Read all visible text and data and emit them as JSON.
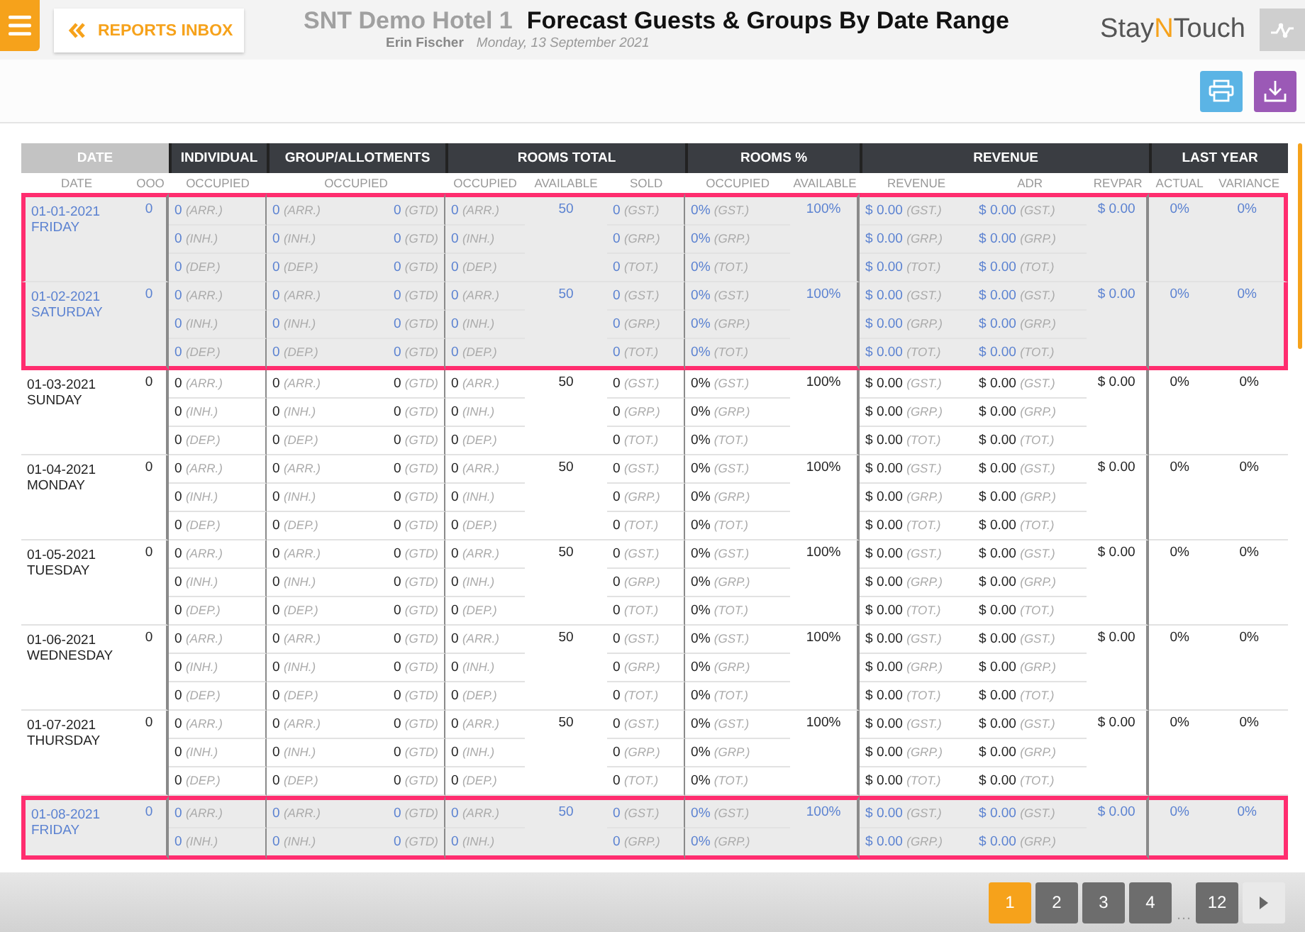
{
  "header": {
    "back_button": "REPORTS INBOX",
    "hotel": "SNT Demo Hotel 1",
    "report_title": "Forecast Guests & Groups By Date Range",
    "user": "Erin Fischer",
    "date": "Monday, 13 September 2021",
    "logo": {
      "before": "Stay",
      "accent": "N",
      "after": "Touch"
    }
  },
  "table": {
    "groups": [
      {
        "label": "DATE",
        "kind": "light"
      },
      {
        "label": "INDIVIDUAL",
        "kind": "dark"
      },
      {
        "label": "GROUP/ALLOTMENTS",
        "kind": "dark"
      },
      {
        "label": "ROOMS TOTAL",
        "kind": "dark"
      },
      {
        "label": "ROOMS %",
        "kind": "dark"
      },
      {
        "label": "REVENUE",
        "kind": "dark"
      },
      {
        "label": "LAST YEAR",
        "kind": "dark"
      }
    ],
    "columns": [
      "DATE",
      "OOO",
      "OCCUPIED",
      "OCCUPIED",
      "OCCUPIED",
      "AVAILABLE",
      "SOLD",
      "OCCUPIED",
      "AVAILABLE",
      "REVENUE",
      "ADR",
      "REVPAR",
      "ACTUAL",
      "VARIANCE"
    ],
    "days": [
      {
        "date": "01-01-2021",
        "weekday": "FRIDAY",
        "highlighted": true,
        "ooo": "0",
        "available": "50",
        "available_pct": "100%",
        "revpar": "$ 0.00",
        "actual": "0%",
        "variance": "0%",
        "lines": [
          {
            "individual": [
              "0",
              "(ARR.)"
            ],
            "group": [
              "0",
              "(ARR.)"
            ],
            "group_gtd": [
              "0",
              "(GTD)"
            ],
            "total": [
              "0",
              "(ARR.)"
            ],
            "sold": [
              "0",
              "(GST.)"
            ],
            "occupied_pct": [
              "0%",
              "(GST.)"
            ],
            "revenue": [
              "$ 0.00",
              "(GST.)"
            ],
            "adr": [
              "$ 0.00",
              "(GST.)"
            ]
          },
          {
            "individual": [
              "0",
              "(INH.)"
            ],
            "group": [
              "0",
              "(INH.)"
            ],
            "group_gtd": [
              "0",
              "(GTD)"
            ],
            "total": [
              "0",
              "(INH.)"
            ],
            "sold": [
              "0",
              "(GRP.)"
            ],
            "occupied_pct": [
              "0%",
              "(GRP.)"
            ],
            "revenue": [
              "$ 0.00",
              "(GRP.)"
            ],
            "adr": [
              "$ 0.00",
              "(GRP.)"
            ]
          },
          {
            "individual": [
              "0",
              "(DEP.)"
            ],
            "group": [
              "0",
              "(DEP.)"
            ],
            "group_gtd": [
              "0",
              "(GTD)"
            ],
            "total": [
              "0",
              "(DEP.)"
            ],
            "sold": [
              "0",
              "(TOT.)"
            ],
            "occupied_pct": [
              "0%",
              "(TOT.)"
            ],
            "revenue": [
              "$ 0.00",
              "(TOT.)"
            ],
            "adr": [
              "$ 0.00",
              "(TOT.)"
            ]
          }
        ]
      },
      {
        "date": "01-02-2021",
        "weekday": "SATURDAY",
        "highlighted": true,
        "ooo": "0",
        "available": "50",
        "available_pct": "100%",
        "revpar": "$ 0.00",
        "actual": "0%",
        "variance": "0%",
        "lines": [
          {
            "individual": [
              "0",
              "(ARR.)"
            ],
            "group": [
              "0",
              "(ARR.)"
            ],
            "group_gtd": [
              "0",
              "(GTD)"
            ],
            "total": [
              "0",
              "(ARR.)"
            ],
            "sold": [
              "0",
              "(GST.)"
            ],
            "occupied_pct": [
              "0%",
              "(GST.)"
            ],
            "revenue": [
              "$ 0.00",
              "(GST.)"
            ],
            "adr": [
              "$ 0.00",
              "(GST.)"
            ]
          },
          {
            "individual": [
              "0",
              "(INH.)"
            ],
            "group": [
              "0",
              "(INH.)"
            ],
            "group_gtd": [
              "0",
              "(GTD)"
            ],
            "total": [
              "0",
              "(INH.)"
            ],
            "sold": [
              "0",
              "(GRP.)"
            ],
            "occupied_pct": [
              "0%",
              "(GRP.)"
            ],
            "revenue": [
              "$ 0.00",
              "(GRP.)"
            ],
            "adr": [
              "$ 0.00",
              "(GRP.)"
            ]
          },
          {
            "individual": [
              "0",
              "(DEP.)"
            ],
            "group": [
              "0",
              "(DEP.)"
            ],
            "group_gtd": [
              "0",
              "(GTD)"
            ],
            "total": [
              "0",
              "(DEP.)"
            ],
            "sold": [
              "0",
              "(TOT.)"
            ],
            "occupied_pct": [
              "0%",
              "(TOT.)"
            ],
            "revenue": [
              "$ 0.00",
              "(TOT.)"
            ],
            "adr": [
              "$ 0.00",
              "(TOT.)"
            ]
          }
        ]
      },
      {
        "date": "01-03-2021",
        "weekday": "SUNDAY",
        "highlighted": false,
        "ooo": "0",
        "available": "50",
        "available_pct": "100%",
        "revpar": "$ 0.00",
        "actual": "0%",
        "variance": "0%",
        "lines": [
          {
            "individual": [
              "0",
              "(ARR.)"
            ],
            "group": [
              "0",
              "(ARR.)"
            ],
            "group_gtd": [
              "0",
              "(GTD)"
            ],
            "total": [
              "0",
              "(ARR.)"
            ],
            "sold": [
              "0",
              "(GST.)"
            ],
            "occupied_pct": [
              "0%",
              "(GST.)"
            ],
            "revenue": [
              "$ 0.00",
              "(GST.)"
            ],
            "adr": [
              "$ 0.00",
              "(GST.)"
            ]
          },
          {
            "individual": [
              "0",
              "(INH.)"
            ],
            "group": [
              "0",
              "(INH.)"
            ],
            "group_gtd": [
              "0",
              "(GTD)"
            ],
            "total": [
              "0",
              "(INH.)"
            ],
            "sold": [
              "0",
              "(GRP.)"
            ],
            "occupied_pct": [
              "0%",
              "(GRP.)"
            ],
            "revenue": [
              "$ 0.00",
              "(GRP.)"
            ],
            "adr": [
              "$ 0.00",
              "(GRP.)"
            ]
          },
          {
            "individual": [
              "0",
              "(DEP.)"
            ],
            "group": [
              "0",
              "(DEP.)"
            ],
            "group_gtd": [
              "0",
              "(GTD)"
            ],
            "total": [
              "0",
              "(DEP.)"
            ],
            "sold": [
              "0",
              "(TOT.)"
            ],
            "occupied_pct": [
              "0%",
              "(TOT.)"
            ],
            "revenue": [
              "$ 0.00",
              "(TOT.)"
            ],
            "adr": [
              "$ 0.00",
              "(TOT.)"
            ]
          }
        ]
      },
      {
        "date": "01-04-2021",
        "weekday": "MONDAY",
        "highlighted": false,
        "ooo": "0",
        "available": "50",
        "available_pct": "100%",
        "revpar": "$ 0.00",
        "actual": "0%",
        "variance": "0%",
        "lines": [
          {
            "individual": [
              "0",
              "(ARR.)"
            ],
            "group": [
              "0",
              "(ARR.)"
            ],
            "group_gtd": [
              "0",
              "(GTD)"
            ],
            "total": [
              "0",
              "(ARR.)"
            ],
            "sold": [
              "0",
              "(GST.)"
            ],
            "occupied_pct": [
              "0%",
              "(GST.)"
            ],
            "revenue": [
              "$ 0.00",
              "(GST.)"
            ],
            "adr": [
              "$ 0.00",
              "(GST.)"
            ]
          },
          {
            "individual": [
              "0",
              "(INH.)"
            ],
            "group": [
              "0",
              "(INH.)"
            ],
            "group_gtd": [
              "0",
              "(GTD)"
            ],
            "total": [
              "0",
              "(INH.)"
            ],
            "sold": [
              "0",
              "(GRP.)"
            ],
            "occupied_pct": [
              "0%",
              "(GRP.)"
            ],
            "revenue": [
              "$ 0.00",
              "(GRP.)"
            ],
            "adr": [
              "$ 0.00",
              "(GRP.)"
            ]
          },
          {
            "individual": [
              "0",
              "(DEP.)"
            ],
            "group": [
              "0",
              "(DEP.)"
            ],
            "group_gtd": [
              "0",
              "(GTD)"
            ],
            "total": [
              "0",
              "(DEP.)"
            ],
            "sold": [
              "0",
              "(TOT.)"
            ],
            "occupied_pct": [
              "0%",
              "(TOT.)"
            ],
            "revenue": [
              "$ 0.00",
              "(TOT.)"
            ],
            "adr": [
              "$ 0.00",
              "(TOT.)"
            ]
          }
        ]
      },
      {
        "date": "01-05-2021",
        "weekday": "TUESDAY",
        "highlighted": false,
        "ooo": "0",
        "available": "50",
        "available_pct": "100%",
        "revpar": "$ 0.00",
        "actual": "0%",
        "variance": "0%",
        "lines": [
          {
            "individual": [
              "0",
              "(ARR.)"
            ],
            "group": [
              "0",
              "(ARR.)"
            ],
            "group_gtd": [
              "0",
              "(GTD)"
            ],
            "total": [
              "0",
              "(ARR.)"
            ],
            "sold": [
              "0",
              "(GST.)"
            ],
            "occupied_pct": [
              "0%",
              "(GST.)"
            ],
            "revenue": [
              "$ 0.00",
              "(GST.)"
            ],
            "adr": [
              "$ 0.00",
              "(GST.)"
            ]
          },
          {
            "individual": [
              "0",
              "(INH.)"
            ],
            "group": [
              "0",
              "(INH.)"
            ],
            "group_gtd": [
              "0",
              "(GTD)"
            ],
            "total": [
              "0",
              "(INH.)"
            ],
            "sold": [
              "0",
              "(GRP.)"
            ],
            "occupied_pct": [
              "0%",
              "(GRP.)"
            ],
            "revenue": [
              "$ 0.00",
              "(GRP.)"
            ],
            "adr": [
              "$ 0.00",
              "(GRP.)"
            ]
          },
          {
            "individual": [
              "0",
              "(DEP.)"
            ],
            "group": [
              "0",
              "(DEP.)"
            ],
            "group_gtd": [
              "0",
              "(GTD)"
            ],
            "total": [
              "0",
              "(DEP.)"
            ],
            "sold": [
              "0",
              "(TOT.)"
            ],
            "occupied_pct": [
              "0%",
              "(TOT.)"
            ],
            "revenue": [
              "$ 0.00",
              "(TOT.)"
            ],
            "adr": [
              "$ 0.00",
              "(TOT.)"
            ]
          }
        ]
      },
      {
        "date": "01-06-2021",
        "weekday": "WEDNESDAY",
        "highlighted": false,
        "ooo": "0",
        "available": "50",
        "available_pct": "100%",
        "revpar": "$ 0.00",
        "actual": "0%",
        "variance": "0%",
        "lines": [
          {
            "individual": [
              "0",
              "(ARR.)"
            ],
            "group": [
              "0",
              "(ARR.)"
            ],
            "group_gtd": [
              "0",
              "(GTD)"
            ],
            "total": [
              "0",
              "(ARR.)"
            ],
            "sold": [
              "0",
              "(GST.)"
            ],
            "occupied_pct": [
              "0%",
              "(GST.)"
            ],
            "revenue": [
              "$ 0.00",
              "(GST.)"
            ],
            "adr": [
              "$ 0.00",
              "(GST.)"
            ]
          },
          {
            "individual": [
              "0",
              "(INH.)"
            ],
            "group": [
              "0",
              "(INH.)"
            ],
            "group_gtd": [
              "0",
              "(GTD)"
            ],
            "total": [
              "0",
              "(INH.)"
            ],
            "sold": [
              "0",
              "(GRP.)"
            ],
            "occupied_pct": [
              "0%",
              "(GRP.)"
            ],
            "revenue": [
              "$ 0.00",
              "(GRP.)"
            ],
            "adr": [
              "$ 0.00",
              "(GRP.)"
            ]
          },
          {
            "individual": [
              "0",
              "(DEP.)"
            ],
            "group": [
              "0",
              "(DEP.)"
            ],
            "group_gtd": [
              "0",
              "(GTD)"
            ],
            "total": [
              "0",
              "(DEP.)"
            ],
            "sold": [
              "0",
              "(TOT.)"
            ],
            "occupied_pct": [
              "0%",
              "(TOT.)"
            ],
            "revenue": [
              "$ 0.00",
              "(TOT.)"
            ],
            "adr": [
              "$ 0.00",
              "(TOT.)"
            ]
          }
        ]
      },
      {
        "date": "01-07-2021",
        "weekday": "THURSDAY",
        "highlighted": false,
        "ooo": "0",
        "available": "50",
        "available_pct": "100%",
        "revpar": "$ 0.00",
        "actual": "0%",
        "variance": "0%",
        "lines": [
          {
            "individual": [
              "0",
              "(ARR.)"
            ],
            "group": [
              "0",
              "(ARR.)"
            ],
            "group_gtd": [
              "0",
              "(GTD)"
            ],
            "total": [
              "0",
              "(ARR.)"
            ],
            "sold": [
              "0",
              "(GST.)"
            ],
            "occupied_pct": [
              "0%",
              "(GST.)"
            ],
            "revenue": [
              "$ 0.00",
              "(GST.)"
            ],
            "adr": [
              "$ 0.00",
              "(GST.)"
            ]
          },
          {
            "individual": [
              "0",
              "(INH.)"
            ],
            "group": [
              "0",
              "(INH.)"
            ],
            "group_gtd": [
              "0",
              "(GTD)"
            ],
            "total": [
              "0",
              "(INH.)"
            ],
            "sold": [
              "0",
              "(GRP.)"
            ],
            "occupied_pct": [
              "0%",
              "(GRP.)"
            ],
            "revenue": [
              "$ 0.00",
              "(GRP.)"
            ],
            "adr": [
              "$ 0.00",
              "(GRP.)"
            ]
          },
          {
            "individual": [
              "0",
              "(DEP.)"
            ],
            "group": [
              "0",
              "(DEP.)"
            ],
            "group_gtd": [
              "0",
              "(GTD)"
            ],
            "total": [
              "0",
              "(DEP.)"
            ],
            "sold": [
              "0",
              "(TOT.)"
            ],
            "occupied_pct": [
              "0%",
              "(TOT.)"
            ],
            "revenue": [
              "$ 0.00",
              "(TOT.)"
            ],
            "adr": [
              "$ 0.00",
              "(TOT.)"
            ]
          }
        ]
      },
      {
        "date": "01-08-2021",
        "weekday": "FRIDAY",
        "highlighted": true,
        "ooo": "0",
        "available": "50",
        "available_pct": "100%",
        "revpar": "$ 0.00",
        "actual": "0%",
        "variance": "0%",
        "lines": [
          {
            "individual": [
              "0",
              "(ARR.)"
            ],
            "group": [
              "0",
              "(ARR.)"
            ],
            "group_gtd": [
              "0",
              "(GTD)"
            ],
            "total": [
              "0",
              "(ARR.)"
            ],
            "sold": [
              "0",
              "(GST.)"
            ],
            "occupied_pct": [
              "0%",
              "(GST.)"
            ],
            "revenue": [
              "$ 0.00",
              "(GST.)"
            ],
            "adr": [
              "$ 0.00",
              "(GST.)"
            ]
          },
          {
            "individual": [
              "0",
              "(INH.)"
            ],
            "group": [
              "0",
              "(INH.)"
            ],
            "group_gtd": [
              "0",
              "(GTD)"
            ],
            "total": [
              "0",
              "(INH.)"
            ],
            "sold": [
              "0",
              "(GRP.)"
            ],
            "occupied_pct": [
              "0%",
              "(GRP.)"
            ],
            "revenue": [
              "$ 0.00",
              "(GRP.)"
            ],
            "adr": [
              "$ 0.00",
              "(GRP.)"
            ]
          }
        ]
      }
    ]
  },
  "pagination": {
    "pages": [
      {
        "label": "1",
        "selected": true
      },
      {
        "label": "2",
        "selected": false
      },
      {
        "label": "3",
        "selected": false
      },
      {
        "label": "4",
        "selected": false
      },
      {
        "label": "…",
        "kind": "gap"
      },
      {
        "label": "12",
        "selected": false
      }
    ]
  }
}
